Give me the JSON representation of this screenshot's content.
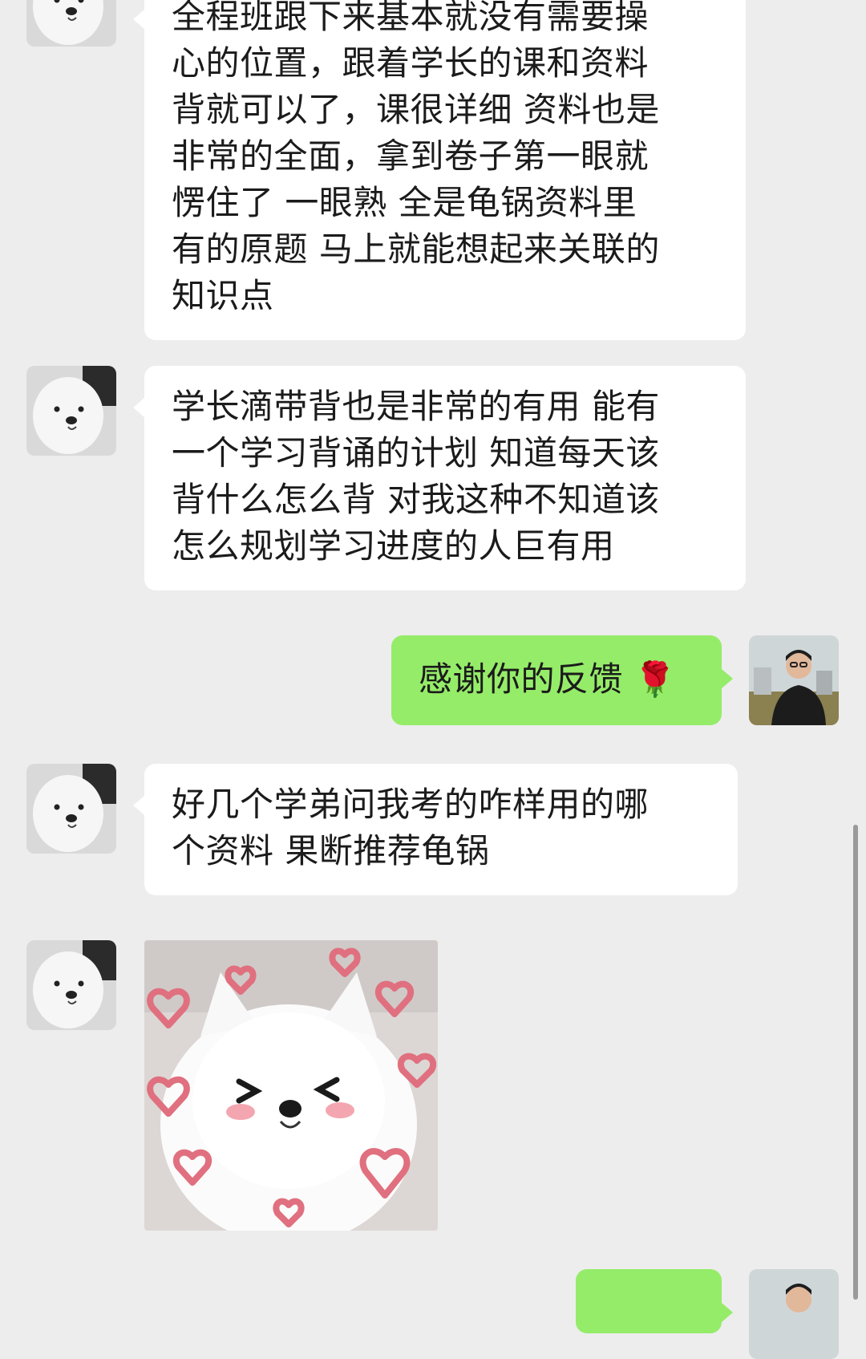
{
  "messages": [
    {
      "id": "msg1",
      "from": "contact",
      "lines": [
        "全程班跟下来基本就没有需要操",
        "心的位置，跟着学长的课和资料",
        "背就可以了，课很详细 资料也是",
        "非常的全面，拿到卷子第一眼就",
        "愣住了 一眼熟 全是龟锅资料里",
        "有的原题 马上就能想起来关联的",
        "知识点"
      ]
    },
    {
      "id": "msg2",
      "from": "contact",
      "lines": [
        "学长滴带背也是非常的有用 能有",
        "一个学习背诵的计划 知道每天该",
        "背什么怎么背 对我这种不知道该",
        "怎么规划学习进度的人巨有用"
      ]
    },
    {
      "id": "msg3",
      "from": "self",
      "text": "感谢你的反馈",
      "emoji": "🌹"
    },
    {
      "id": "msg4",
      "from": "contact",
      "lines": [
        "好几个学弟问我考的咋样用的哪",
        "个资料 果断推荐龟锅"
      ]
    },
    {
      "id": "msg5",
      "from": "contact",
      "type": "sticker",
      "sticker_icon": "fluffy-white-dog-with-hearts-sticker"
    }
  ],
  "colors": {
    "background": "#ededed",
    "incoming_bubble": "#ffffff",
    "outgoing_bubble": "#95ec69",
    "text": "#1b1b1b"
  },
  "icons": {
    "contact_avatar": "seal-avatar-icon",
    "self_avatar": "person-photo-avatar-icon"
  }
}
